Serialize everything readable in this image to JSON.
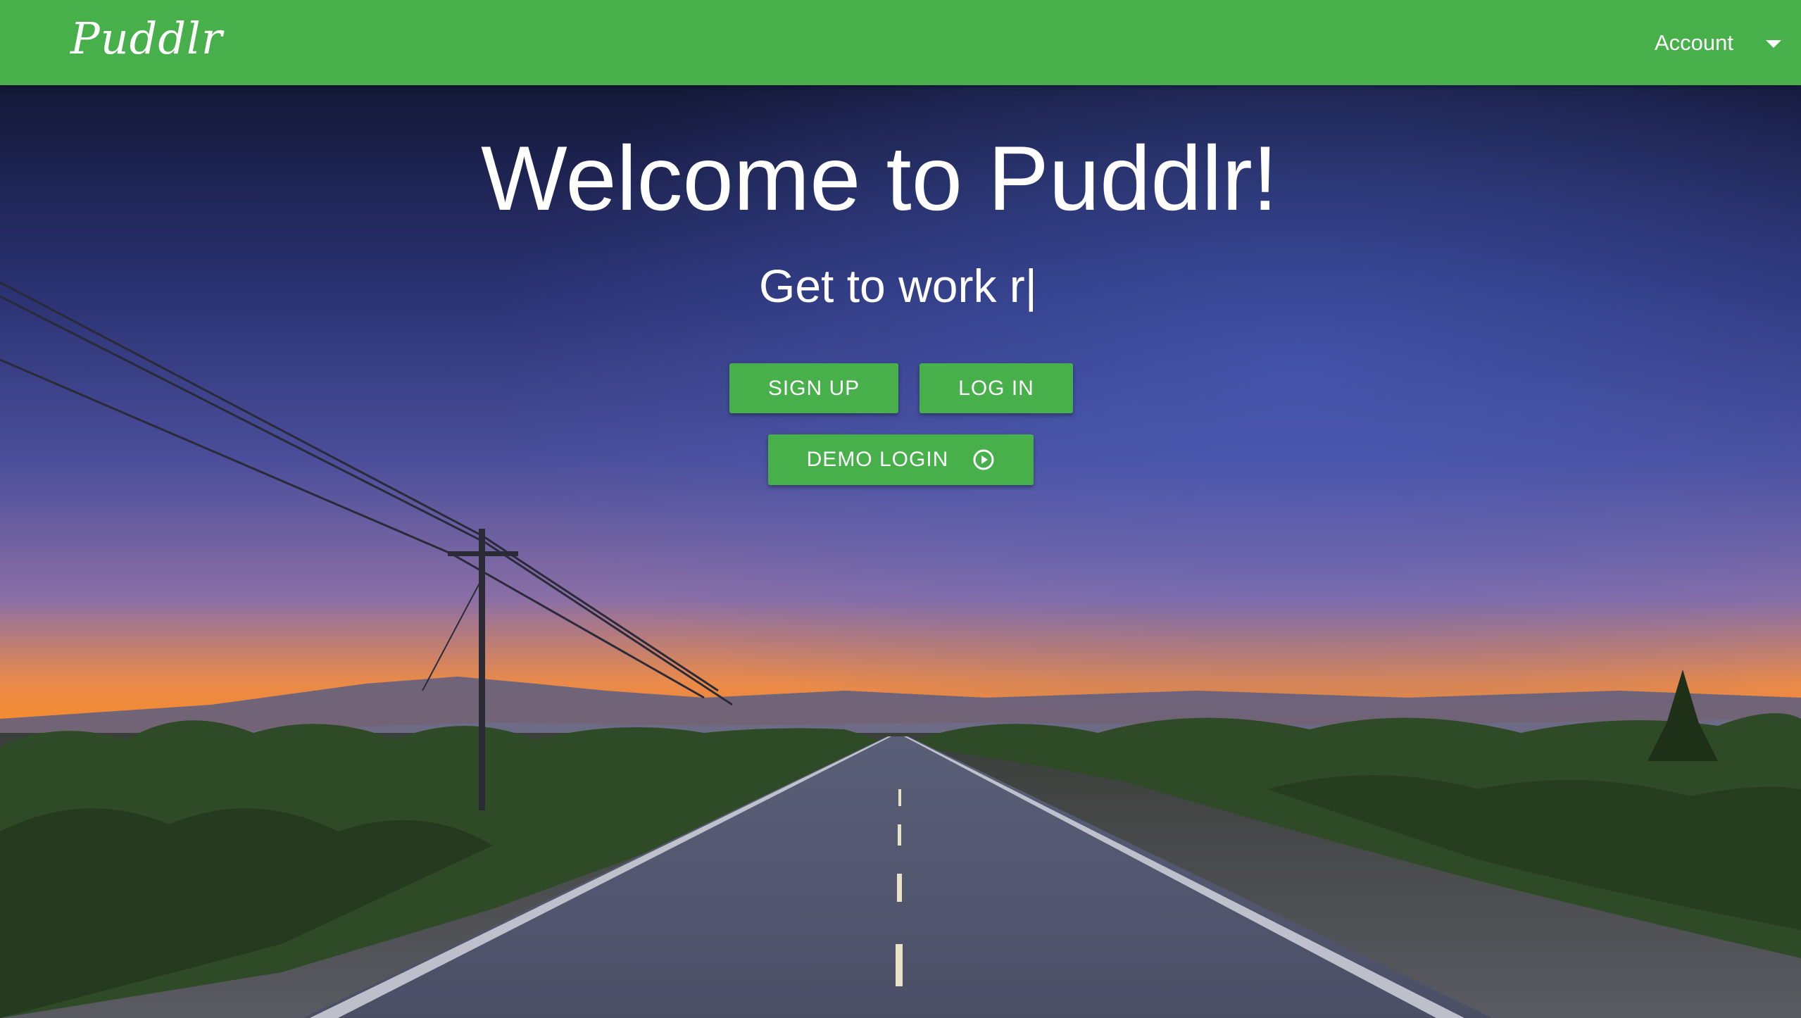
{
  "navbar": {
    "logo": "Puddlr",
    "account_label": "Account"
  },
  "hero": {
    "headline": "Welcome to Puddlr!",
    "typed_text": "Get to work r|",
    "buttons": {
      "signup": "SIGN UP",
      "login": "LOG IN",
      "demo": "DEMO LOGIN"
    }
  },
  "colors": {
    "brand_green": "#47b04b",
    "text_white": "#ffffff"
  },
  "icons": {
    "account_menu": "chevron-down-icon",
    "demo": "play-circle-icon"
  }
}
